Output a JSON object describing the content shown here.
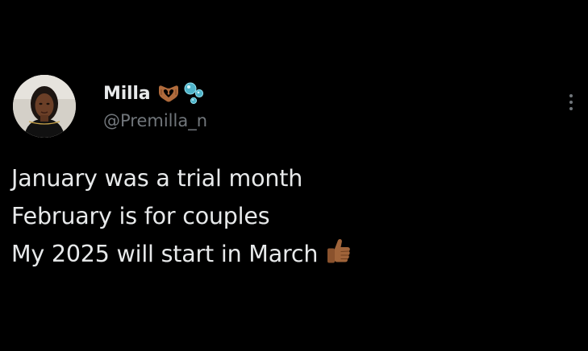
{
  "tweet": {
    "author": {
      "display_name": "Milla",
      "handle": "@Premilla_n",
      "name_emojis": [
        "heart-hands-icon",
        "bubbles-icon"
      ]
    },
    "text_lines": [
      "January was a trial month",
      "February is for couples",
      "My 2025 will start in March"
    ],
    "text_emoji": "thumbs-up-icon"
  },
  "colors": {
    "background": "#000000",
    "primary_text": "#e7e9ea",
    "secondary_text": "#71767b",
    "emoji_skin": "#a0643a"
  }
}
